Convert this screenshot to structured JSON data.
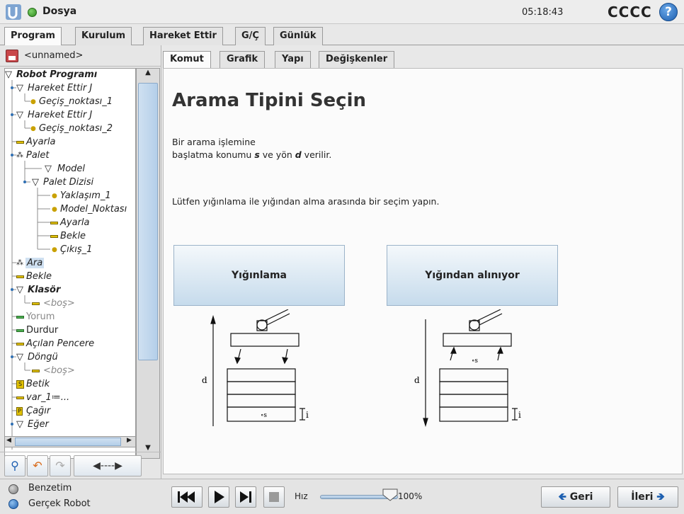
{
  "header": {
    "menu_label": "Dosya",
    "clock": "05:18:43",
    "robot_name": "CCCC",
    "help": "?"
  },
  "main_tabs": [
    {
      "label": "Program",
      "active": true
    },
    {
      "label": "Kurulum"
    },
    {
      "label": "Hareket Ettir"
    },
    {
      "label": "G/Ç"
    },
    {
      "label": "Günlük"
    }
  ],
  "file": {
    "name": "<unnamed>"
  },
  "tree": [
    {
      "label": "Robot Programı",
      "depth": 0
    },
    {
      "label": "Hareket Ettir J",
      "depth": 1
    },
    {
      "label": "Geçiş_noktası_1",
      "depth": 2
    },
    {
      "label": "Hareket Ettir J",
      "depth": 1
    },
    {
      "label": "Geçiş_noktası_2",
      "depth": 2
    },
    {
      "label": "Ayarla",
      "depth": 1
    },
    {
      "label": "Palet",
      "depth": 1
    },
    {
      "label": "Model",
      "depth": 2
    },
    {
      "label": "Palet Dizisi",
      "depth": 2
    },
    {
      "label": "Yaklaşım_1",
      "depth": 3
    },
    {
      "label": "Model_Noktası",
      "depth": 3
    },
    {
      "label": "Ayarla",
      "depth": 3
    },
    {
      "label": "Bekle",
      "depth": 3
    },
    {
      "label": "Çıkış_1",
      "depth": 3
    },
    {
      "label": "Ara",
      "depth": 1,
      "selected": true
    },
    {
      "label": "Bekle",
      "depth": 1
    },
    {
      "label": "Klasör",
      "depth": 1
    },
    {
      "label": "<boş>",
      "depth": 2
    },
    {
      "label": "Yorum",
      "depth": 1
    },
    {
      "label": "Durdur",
      "depth": 1
    },
    {
      "label": "Açılan Pencere",
      "depth": 1
    },
    {
      "label": "Döngü",
      "depth": 1
    },
    {
      "label": "<boş>",
      "depth": 2
    },
    {
      "label": "Betik",
      "depth": 1
    },
    {
      "label": "var_1≔...",
      "depth": 1
    },
    {
      "label": "Çağır",
      "depth": 1
    },
    {
      "label": "Eğer",
      "depth": 1
    }
  ],
  "sub_tabs": [
    {
      "label": "Komut",
      "active": true
    },
    {
      "label": "Grafik"
    },
    {
      "label": "Yapı"
    },
    {
      "label": "Değişkenler"
    }
  ],
  "content": {
    "heading": "Arama Tipini Seçin",
    "desc_line1": "Bir arama işlemine",
    "desc_line2_pre": "başlatma konumu ",
    "desc_s": "s",
    "desc_mid": " ve yön ",
    "desc_d": "d",
    "desc_post": " verilir.",
    "instruction": "Lütfen yığınlama ile yığından alma arasında bir seçim yapın.",
    "stack_button": "Yığınlama",
    "destack_button": "Yığından alınıyor",
    "diagram_d": "d",
    "diagram_s": "s",
    "diagram_i": "i"
  },
  "bottom": {
    "simulation_label": "Benzetim",
    "real_robot_label": "Gerçek Robot",
    "speed_label": "Hız",
    "speed_value": "100%",
    "speed_fraction": 1.0,
    "back_label": "Geri",
    "next_label": "İleri"
  },
  "colors": {
    "accent": "#1d5fb0",
    "button_top": "#f4f8fb",
    "button_bottom": "#c6dbec"
  }
}
